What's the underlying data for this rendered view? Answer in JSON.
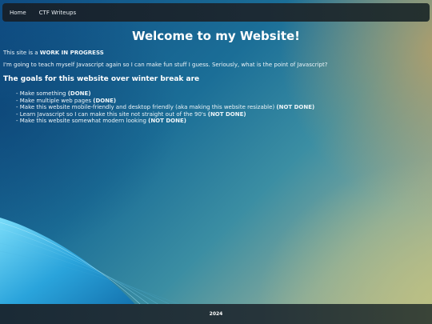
{
  "nav": {
    "home": "Home",
    "ctf": "CTF Writeups"
  },
  "main": {
    "title": "Welcome to my Website!",
    "intro_prefix": "This site is a",
    "intro_status": "WORK IN PROGRESS",
    "paragraph": "I'm going to teach myself Javascript again so I can make fun stuff I guess. Seriously, what is the point of Javascript?",
    "goals_heading": "The goals for this website over winter break are",
    "goals": [
      {
        "text": "- Make something",
        "status": "(DONE)"
      },
      {
        "text": "- Make multiple web pages",
        "status": "(DONE)"
      },
      {
        "text": "- Make this website mobile-friendly and desktop friendly (aka making this website resizable)",
        "status": "(NOT DONE)"
      },
      {
        "text": "- Learn Javascript so I can make this site not straight out of the 90's",
        "status": "(NOT DONE)"
      },
      {
        "text": "- Make this website somewhat modern looking",
        "status": "(NOT DONE)"
      }
    ]
  },
  "footer": {
    "year": "2024"
  }
}
